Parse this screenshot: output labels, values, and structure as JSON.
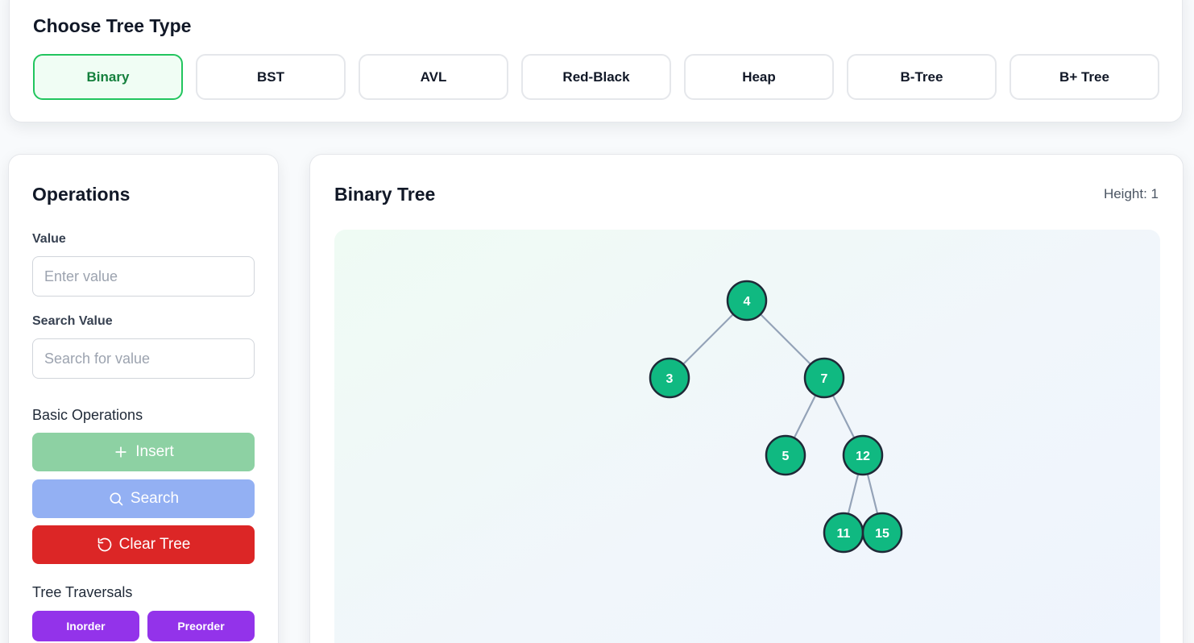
{
  "tree_type_panel": {
    "title": "Choose Tree Type",
    "types": [
      "Binary",
      "BST",
      "AVL",
      "Red-Black",
      "Heap",
      "B-Tree",
      "B+ Tree"
    ],
    "active": "Binary"
  },
  "operations": {
    "title": "Operations",
    "value_label": "Value",
    "value_placeholder": "Enter value",
    "value_current": "",
    "search_label": "Search Value",
    "search_placeholder": "Search for value",
    "search_current": "",
    "basic_label": "Basic Operations",
    "insert_label": "Insert",
    "search_button_label": "Search",
    "clear_label": "Clear Tree",
    "traversals_label": "Tree Traversals",
    "traversals": [
      "Inorder",
      "Preorder"
    ]
  },
  "visualization": {
    "title": "Binary Tree",
    "height_text": "Height: 1",
    "colors": {
      "node_fill": "#10b981",
      "node_stroke": "#1f2937",
      "edge": "#94a3b8"
    },
    "tree": {
      "value": "4",
      "left": {
        "value": "3"
      },
      "right": {
        "value": "7",
        "left": {
          "value": "5"
        },
        "right": {
          "value": "12",
          "left": {
            "value": "11"
          },
          "right": {
            "value": "15"
          }
        }
      }
    }
  }
}
